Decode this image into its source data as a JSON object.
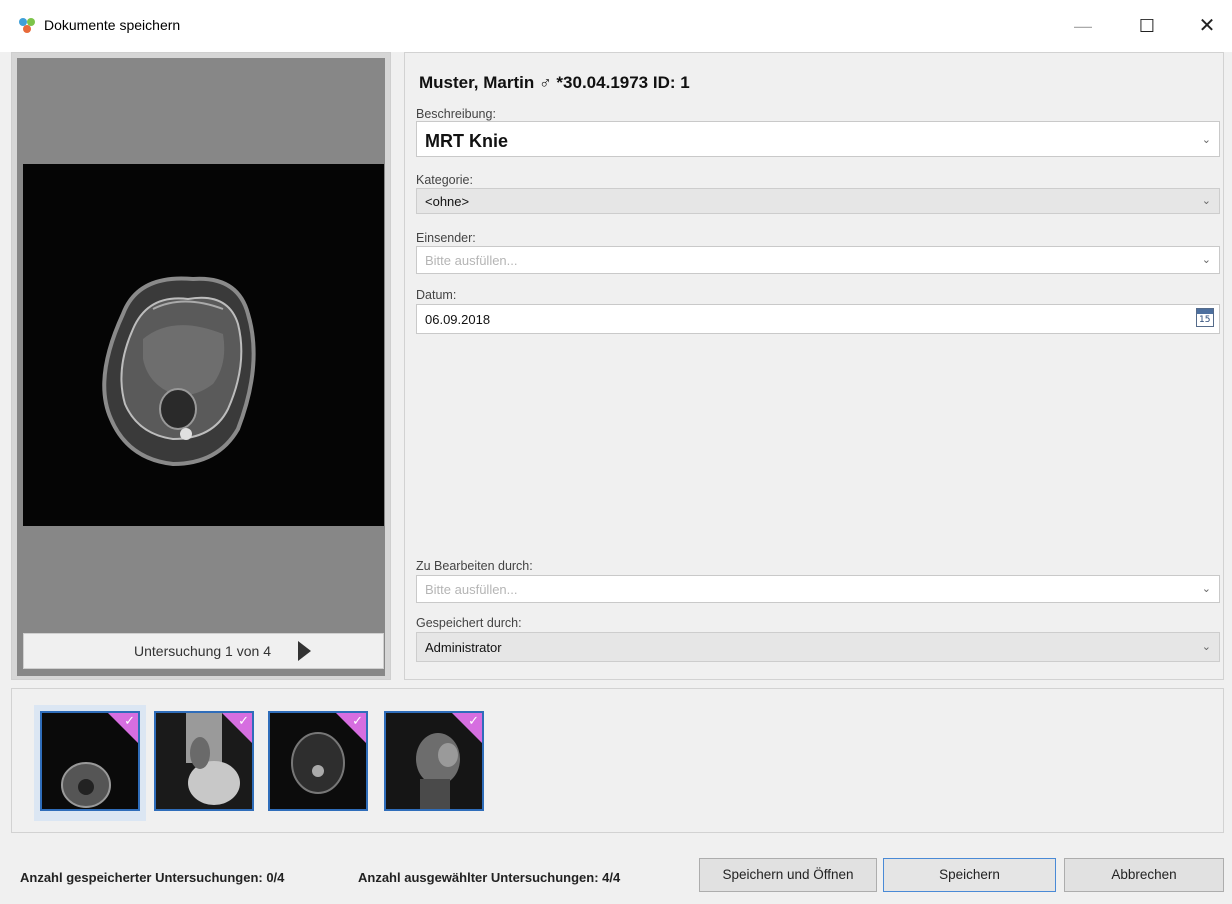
{
  "window": {
    "title": "Dokumente speichern"
  },
  "preview": {
    "nav_label": "Untersuchung 1 von 4"
  },
  "patient": {
    "header": "Muster, Martin ♂ *30.04.1973  ID: 1"
  },
  "form": {
    "beschreibung": {
      "label": "Beschreibung:",
      "value": "MRT Knie"
    },
    "kategorie": {
      "label": "Kategorie:",
      "value": "<ohne>"
    },
    "einsender": {
      "label": "Einsender:",
      "placeholder": "Bitte ausfüllen..."
    },
    "datum": {
      "label": "Datum:",
      "value": "06.09.2018",
      "calendar_day": "15"
    },
    "zu_bearbeiten": {
      "label": "Zu Bearbeiten durch:",
      "placeholder": "Bitte ausfüllen..."
    },
    "gespeichert": {
      "label": "Gespeichert durch:",
      "value": "Administrator"
    }
  },
  "thumbnails": [
    {
      "name": "mrt-axial",
      "checked": true
    },
    {
      "name": "mrt-sagittal",
      "checked": true
    },
    {
      "name": "mrt-axial-2",
      "checked": true
    },
    {
      "name": "mrt-coronal",
      "checked": true
    }
  ],
  "footer": {
    "saved_count": "Anzahl gespeicherter Untersuchungen: 0/4",
    "selected_count": "Anzahl ausgewählter Untersuchungen: 4/4",
    "save_open": "Speichern und Öffnen",
    "save": "Speichern",
    "cancel": "Abbrechen"
  },
  "colors": {
    "selection_corner": "#d66ee0",
    "accent_border": "#2f6dba"
  }
}
